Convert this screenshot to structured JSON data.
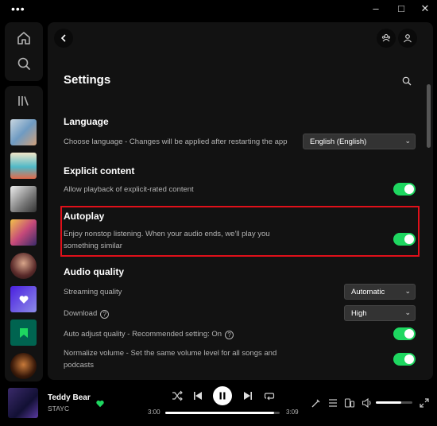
{
  "titlebar": {
    "menu_icon": "ellipsis-icon",
    "minimize": "–",
    "maximize": "□",
    "close": "✕"
  },
  "nav": {
    "home_icon": "home-icon",
    "search_icon": "search-icon",
    "library_icon": "library-icon"
  },
  "library": {
    "items": [
      {
        "name": "playlist-1",
        "color": "#7fa7c8"
      },
      {
        "name": "playlist-2",
        "color": "#e06b4a"
      },
      {
        "name": "playlist-3",
        "color": "#9a9a9a"
      },
      {
        "name": "playlist-4",
        "color": "#c85a8a"
      },
      {
        "name": "playlist-5",
        "color": "#6a3a3a"
      },
      {
        "name": "liked-songs",
        "color": "#5a3ae0"
      },
      {
        "name": "your-episodes",
        "color": "#1a6b4a"
      },
      {
        "name": "artist",
        "color": "#3a2a1a"
      }
    ]
  },
  "settings": {
    "title": "Settings",
    "language": {
      "heading": "Language",
      "description": "Choose language - Changes will be applied after restarting the app",
      "value": "English (English)"
    },
    "explicit": {
      "heading": "Explicit content",
      "description": "Allow playback of explicit-rated content",
      "enabled": true
    },
    "autoplay": {
      "heading": "Autoplay",
      "description_line1": "Enjoy nonstop listening. When your audio ends, we'll play you",
      "description_line2": "something similar",
      "enabled": true
    },
    "audio_quality": {
      "heading": "Audio quality",
      "streaming_label": "Streaming quality",
      "streaming_value": "Automatic",
      "download_label": "Download",
      "download_value": "High",
      "auto_adjust_label": "Auto adjust quality - Recommended setting: On",
      "auto_adjust_enabled": true,
      "normalize_line1": "Normalize volume - Set the same volume level for all songs and",
      "normalize_line2": "podcasts",
      "normalize_enabled": true
    }
  },
  "player": {
    "song": "Teddy Bear",
    "artist": "STAYC",
    "elapsed": "3:00",
    "duration": "3:09",
    "progress": 0.95,
    "volume": 0.7,
    "accent": "#1ed760"
  }
}
